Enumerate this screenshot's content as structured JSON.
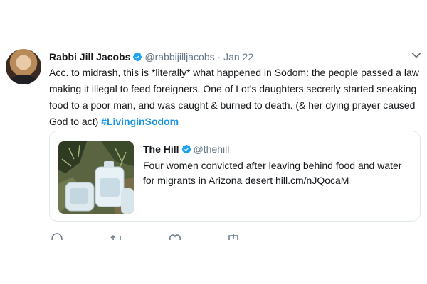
{
  "tweet": {
    "author_name": "Rabbi Jill Jacobs",
    "handle": "@rabbijilljacobs",
    "separator": "·",
    "date": "Jan 22",
    "text": "Acc. to midrash, this is *literally* what happened in Sodom: the people passed a law making it illegal to feed foreigners. One of Lot's daughters secretly started sneaking food to a poor man, and was caught & burned to death. (& her dying prayer caused God to act) ",
    "hashtag": "#LivinginSodom"
  },
  "quoted": {
    "author_name": "The Hill",
    "handle": "@thehill",
    "text": "Four women convicted after leaving behind food and water for migrants in Arizona desert hill.cm/nJQocaM"
  },
  "colors": {
    "verified": "#1da1f2",
    "hashtag": "#1b95e0",
    "secondary_text": "#657786",
    "border": "#e1e8ed"
  },
  "icons": {
    "verified": "verified-badge-icon",
    "menu": "chevron-down-icon",
    "reply": "reply-icon",
    "retweet": "retweet-icon",
    "like": "heart-icon",
    "share": "share-icon"
  }
}
